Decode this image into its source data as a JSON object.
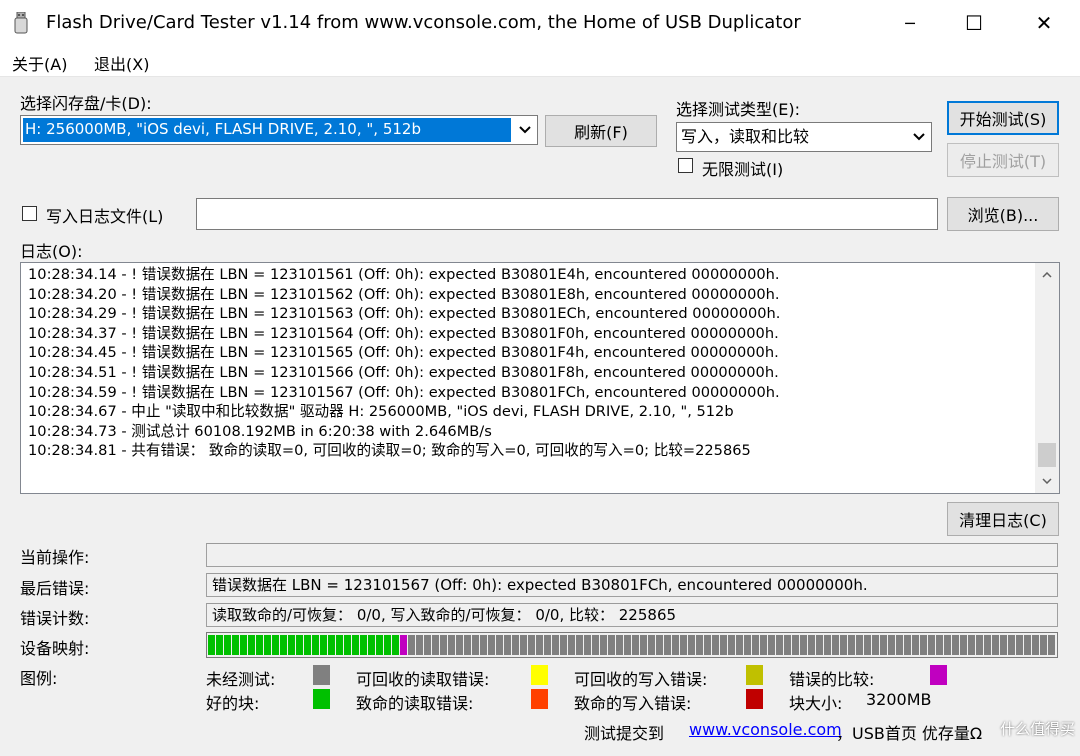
{
  "window": {
    "title": "Flash Drive/Card Tester v1.14 from www.vconsole.com, the Home of USB Duplicator",
    "minimize_glyph": "─",
    "maximize_glyph": "☐",
    "close_glyph": "✕"
  },
  "menu": {
    "items": [
      {
        "label": "关于(A)"
      },
      {
        "label": "退出(X)"
      }
    ]
  },
  "drive": {
    "label": "选择闪存盘/卡(D):",
    "selected": "H: 256000MB, \"iOS devi, FLASH DRIVE, 2.10, \", 512b",
    "refresh_button": "刷新(F)"
  },
  "test_type": {
    "label": "选择测试类型(E):",
    "selected": "写入，读取和比较",
    "infinite_label": "无限测试(I)",
    "infinite_checked": false
  },
  "buttons": {
    "start": "开始测试(S)",
    "stop": "停止测试(T)",
    "browse": "浏览(B)...",
    "clear_log": "清理日志(C)"
  },
  "log_file": {
    "label": "写入日志文件(L)",
    "checked": false,
    "path": ""
  },
  "log": {
    "label": "日志(O):",
    "lines": [
      "10:28:34.14 - ! 错误数据在 LBN = 123101561 (Off: 0h): expected B30801E4h, encountered 00000000h.",
      "10:28:34.20 - ! 错误数据在 LBN = 123101562 (Off: 0h): expected B30801E8h, encountered 00000000h.",
      "10:28:34.29 - ! 错误数据在 LBN = 123101563 (Off: 0h): expected B30801ECh, encountered 00000000h.",
      "10:28:34.37 - ! 错误数据在 LBN = 123101564 (Off: 0h): expected B30801F0h, encountered 00000000h.",
      "10:28:34.45 - ! 错误数据在 LBN = 123101565 (Off: 0h): expected B30801F4h, encountered 00000000h.",
      "10:28:34.51 - ! 错误数据在 LBN = 123101566 (Off: 0h): expected B30801F8h, encountered 00000000h.",
      "10:28:34.59 - ! 错误数据在 LBN = 123101567 (Off: 0h): expected B30801FCh, encountered 00000000h.",
      "10:28:34.67 - 中止 \"读取中和比较数据\" 驱动器 H: 256000MB, \"iOS devi, FLASH DRIVE, 2.10, \", 512b",
      "10:28:34.73 - 测试总计 60108.192MB in 6:20:38 with  2.646MB/s",
      "10:28:34.81 - 共有错误：  致命的读取=0, 可回收的读取=0; 致命的写入=0, 可回收的写入=0; 比较=225865"
    ]
  },
  "status": {
    "current_op_label": "当前操作:",
    "current_op_value": "",
    "last_error_label": "最后错误:",
    "last_error_value": "错误数据在 LBN = 123101567 (Off: 0h): expected B30801FCh, encountered 00000000h.",
    "error_count_label": "错误计数:",
    "error_count_value": "读取致命的/可恢复：  0/0, 写入致命的/可恢复：  0/0, 比较：  225865",
    "device_map_label": "设备映射:",
    "device_map": {
      "good_blocks": 24,
      "compare_error_blocks": 1,
      "untested_blocks": 81
    }
  },
  "legend": {
    "label": "图例:",
    "items": [
      {
        "label": "未经测试:",
        "color": "#808080"
      },
      {
        "label": "可回收的读取错误:",
        "color": "#ffff00"
      },
      {
        "label": "可回收的写入错误:",
        "color": "#c0c000"
      },
      {
        "label": "错误的比较:",
        "color": "#c000c0"
      },
      {
        "label": "好的块:",
        "color": "#00c000"
      },
      {
        "label": "致命的读取错误:",
        "color": "#ff4000"
      },
      {
        "label": "致命的写入错误:",
        "color": "#c00000"
      }
    ],
    "block_size_label": "块大小:",
    "block_size_value": "3200MB"
  },
  "footer": {
    "submit_label": "测试提交到",
    "link_text": "www.vconsole.com",
    "suffix": "，USB首页 优存量Ω",
    "watermark": "什么值得买"
  },
  "colors": {
    "selection": "#0078d7",
    "good": "#00c000",
    "compare_error": "#c000c0",
    "untested": "#808080"
  }
}
